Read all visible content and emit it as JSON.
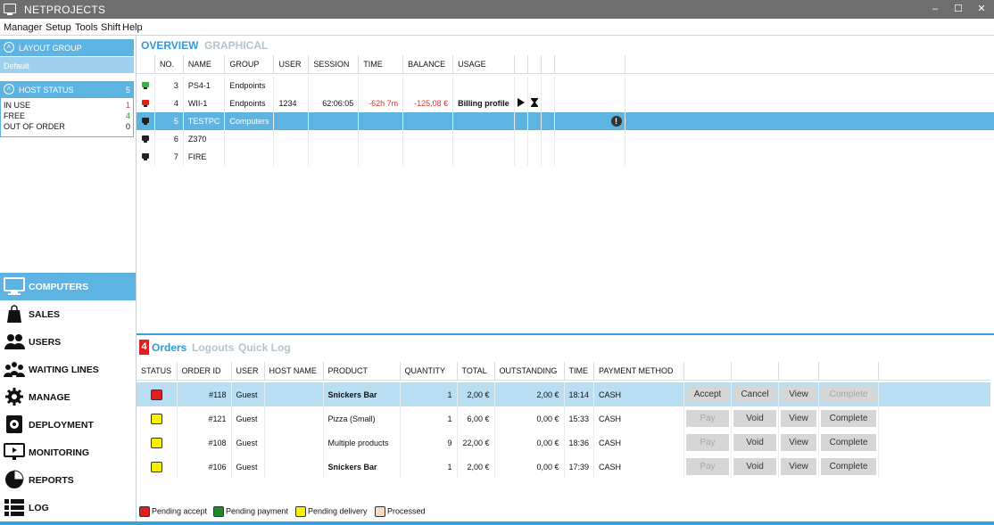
{
  "window": {
    "title": "NETPROJECTS",
    "minimize": "–",
    "maximize": "☐",
    "close": "✕"
  },
  "menu": [
    "Manager",
    "Setup",
    "Tools",
    "Shift",
    "Help"
  ],
  "sidebar": {
    "layout_group": {
      "title": "LAYOUT GROUP",
      "selected": "Default"
    },
    "host_status": {
      "title": "HOST STATUS",
      "count": "5",
      "rows": [
        {
          "label": "IN USE",
          "value": "1",
          "color": "#e03030"
        },
        {
          "label": "FREE",
          "value": "4",
          "color": "#2a9a2a"
        },
        {
          "label": "OUT OF ORDER",
          "value": "0",
          "color": "#111111"
        }
      ]
    },
    "nav": [
      {
        "label": "COMPUTERS",
        "icon": "monitor-icon",
        "active": true
      },
      {
        "label": "SALES",
        "icon": "shopping-bag-icon"
      },
      {
        "label": "USERS",
        "icon": "users-icon"
      },
      {
        "label": "WAITING LINES",
        "icon": "queue-icon"
      },
      {
        "label": "MANAGE",
        "icon": "gear-icon"
      },
      {
        "label": "DEPLOYMENT",
        "icon": "deployment-icon"
      },
      {
        "label": "MONITORING",
        "icon": "monitoring-icon"
      },
      {
        "label": "REPORTS",
        "icon": "pie-chart-icon"
      },
      {
        "label": "LOG",
        "icon": "list-icon"
      }
    ]
  },
  "main": {
    "tabs": [
      {
        "label": "OVERVIEW",
        "active": true
      },
      {
        "label": "GRAPHICAL",
        "active": false
      }
    ],
    "hosts": {
      "columns": [
        "",
        "NO.",
        "NAME",
        "GROUP",
        "USER",
        "SESSION",
        "TIME",
        "BALANCE",
        "USAGE",
        "",
        "",
        "",
        ""
      ],
      "rows": [
        {
          "status": "green",
          "no": "3",
          "name": "PS4-1",
          "group": "Endpoints",
          "user": "",
          "session": "",
          "time": "",
          "balance": "",
          "usage": "",
          "selected": false
        },
        {
          "status": "red",
          "no": "4",
          "name": "WII-1",
          "group": "Endpoints",
          "user": "1234",
          "session": "62:06:05",
          "time": "-62h 7m",
          "balance": "-125,08 €",
          "usage": "Billing profile",
          "selected": false,
          "icons": [
            "play-icon",
            "hourglass-icon"
          ]
        },
        {
          "status": "dark",
          "no": "5",
          "name": "TESTPC",
          "group": "Computers",
          "user": "",
          "session": "",
          "time": "",
          "balance": "",
          "usage": "",
          "selected": true,
          "alert": "!"
        },
        {
          "status": "dark",
          "no": "6",
          "name": "Z370",
          "group": "",
          "user": "",
          "session": "",
          "time": "",
          "balance": "",
          "usage": "",
          "selected": false
        },
        {
          "status": "dark",
          "no": "7",
          "name": "FIRE",
          "group": "",
          "user": "",
          "session": "",
          "time": "",
          "balance": "",
          "usage": "",
          "selected": false
        }
      ]
    },
    "orders_tabs": {
      "badge": "4",
      "tabs": [
        "Orders",
        "Logouts",
        "Quick Log"
      ]
    },
    "orders": {
      "columns": [
        "STATUS",
        "ORDER ID",
        "USER",
        "HOST NAME",
        "PRODUCT",
        "QUANTITY",
        "TOTAL",
        "OUTSTANDING",
        "TIME",
        "PAYMENT METHOD",
        "",
        "",
        "",
        ""
      ],
      "rows": [
        {
          "status_color": "#e02020",
          "order_id": "#118",
          "user": "Guest",
          "host": "",
          "product": "Snickers Bar",
          "qty": "1",
          "total": "2,00 €",
          "outstanding": "2,00 €",
          "time": "18:14",
          "method": "CASH",
          "actions": [
            "Accept",
            "Cancel",
            "View",
            "Complete"
          ],
          "disabled": [
            false,
            false,
            false,
            true
          ],
          "selected": true
        },
        {
          "status_color": "#f5f000",
          "order_id": "#121",
          "user": "Guest",
          "host": "",
          "product": "Pizza (Small)",
          "qty": "1",
          "total": "6,00 €",
          "outstanding": "0,00 €",
          "time": "15:33",
          "method": "CASH",
          "actions": [
            "Pay",
            "Void",
            "View",
            "Complete"
          ],
          "disabled": [
            true,
            false,
            false,
            false
          ],
          "selected": false
        },
        {
          "status_color": "#f5f000",
          "order_id": "#108",
          "user": "Guest",
          "host": "",
          "product": "Multiple products",
          "qty": "9",
          "total": "22,00 €",
          "outstanding": "0,00 €",
          "time": "18:36",
          "method": "CASH",
          "actions": [
            "Pay",
            "Void",
            "View",
            "Complete"
          ],
          "disabled": [
            true,
            false,
            false,
            false
          ],
          "selected": false
        },
        {
          "status_color": "#f5f000",
          "order_id": "#106",
          "user": "Guest",
          "host": "",
          "product": "Snickers Bar",
          "qty": "1",
          "total": "2,00 €",
          "outstanding": "0,00 €",
          "time": "17:39",
          "method": "CASH",
          "actions": [
            "Pay",
            "Void",
            "View",
            "Complete"
          ],
          "disabled": [
            true,
            false,
            false,
            false
          ],
          "selected": false
        }
      ]
    },
    "legend": [
      {
        "label": "Pending accept",
        "color": "#e02020"
      },
      {
        "label": "Pending payment",
        "color": "#1e8a2a"
      },
      {
        "label": "Pending delivery",
        "color": "#f5f000"
      },
      {
        "label": "Processed",
        "color": "#f4dcc0"
      }
    ]
  }
}
